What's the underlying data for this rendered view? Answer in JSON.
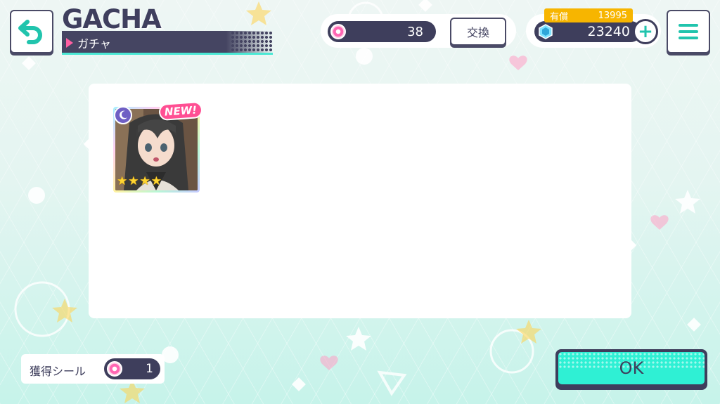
{
  "header": {
    "title": "GACHA",
    "subtitle": "ガチャ",
    "back_icon": "back-arrow-icon",
    "menu_icon": "hamburger-menu-icon"
  },
  "currency": {
    "item_count": "38",
    "exchange_label": "交換",
    "paid_label": "有償",
    "paid_amount": "13995",
    "gem_amount": "23240",
    "add_label": "+"
  },
  "result": {
    "cards": [
      {
        "new_label": "NEW!",
        "rarity_stars": 4,
        "attribute_icon": "moon-icon"
      }
    ]
  },
  "footer": {
    "seal_label": "獲得シール",
    "seal_count": "1",
    "ok_label": "OK"
  },
  "colors": {
    "accent": "#2ff0d4",
    "dark": "#3e3e5c",
    "pink": "#ff4f93",
    "gold": "#f7b500"
  }
}
